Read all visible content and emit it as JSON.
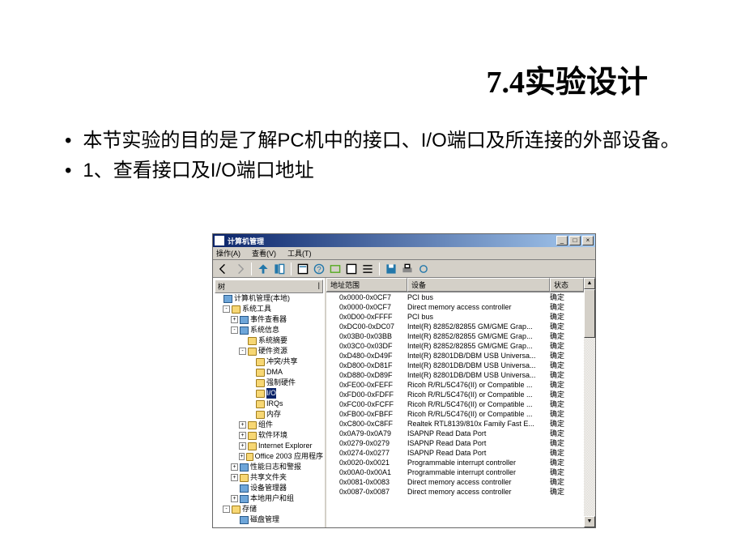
{
  "slide": {
    "title": "7.4实验设计",
    "bullet1": "本节实验的目的是了解PC机中的接口、I/O端口及所连接的外部设备。",
    "bullet2": "1、查看接口及I/O端口地址"
  },
  "window": {
    "title": "计算机管理",
    "menu": {
      "action": "操作(A)",
      "view": "查看(V)",
      "tool": "工具(T)"
    },
    "win_btns": {
      "min": "_",
      "max": "□",
      "close": "×"
    },
    "tree_header": {
      "label": "树",
      "gap": "|"
    },
    "list_header": {
      "addr": "地址范围",
      "device": "设备",
      "status": "状态"
    }
  },
  "tree": [
    {
      "ind": 0,
      "exp": "",
      "icon": "item",
      "label": "计算机管理(本地)"
    },
    {
      "ind": 1,
      "exp": "-",
      "icon": "folder",
      "label": "系统工具"
    },
    {
      "ind": 2,
      "exp": "+",
      "icon": "item",
      "label": "事件查看器"
    },
    {
      "ind": 2,
      "exp": "-",
      "icon": "item",
      "label": "系统信息"
    },
    {
      "ind": 3,
      "exp": "",
      "icon": "folder",
      "label": "系统摘要"
    },
    {
      "ind": 3,
      "exp": "-",
      "icon": "folder",
      "label": "硬件资源"
    },
    {
      "ind": 4,
      "exp": "",
      "icon": "folder",
      "label": "冲突/共享"
    },
    {
      "ind": 4,
      "exp": "",
      "icon": "folder",
      "label": "DMA"
    },
    {
      "ind": 4,
      "exp": "",
      "icon": "folder",
      "label": "强制硬件"
    },
    {
      "ind": 4,
      "exp": "",
      "icon": "folder",
      "label": "I/O",
      "selected": true
    },
    {
      "ind": 4,
      "exp": "",
      "icon": "folder",
      "label": "IRQs"
    },
    {
      "ind": 4,
      "exp": "",
      "icon": "folder",
      "label": "内存"
    },
    {
      "ind": 3,
      "exp": "+",
      "icon": "folder",
      "label": "组件"
    },
    {
      "ind": 3,
      "exp": "+",
      "icon": "folder",
      "label": "软件环境"
    },
    {
      "ind": 3,
      "exp": "+",
      "icon": "folder",
      "label": "Internet Explorer"
    },
    {
      "ind": 3,
      "exp": "+",
      "icon": "folder",
      "label": "Office 2003 应用程序"
    },
    {
      "ind": 2,
      "exp": "+",
      "icon": "item",
      "label": "性能日志和警报"
    },
    {
      "ind": 2,
      "exp": "+",
      "icon": "folder",
      "label": "共享文件夹"
    },
    {
      "ind": 2,
      "exp": "",
      "icon": "item",
      "label": "设备管理器"
    },
    {
      "ind": 2,
      "exp": "+",
      "icon": "item",
      "label": "本地用户和组"
    },
    {
      "ind": 1,
      "exp": "-",
      "icon": "folder",
      "label": "存储"
    },
    {
      "ind": 2,
      "exp": "",
      "icon": "item",
      "label": "磁盘管理"
    }
  ],
  "rows": [
    {
      "addr": "0x0000-0x0CF7",
      "dev": "PCI bus",
      "stat": "确定"
    },
    {
      "addr": "0x0000-0x0CF7",
      "dev": "Direct memory access controller",
      "stat": "确定"
    },
    {
      "addr": "0x0D00-0xFFFF",
      "dev": "PCI bus",
      "stat": "确定"
    },
    {
      "addr": "0xDC00-0xDC07",
      "dev": "Intel(R) 82852/82855 GM/GME Grap...",
      "stat": "确定"
    },
    {
      "addr": "0x03B0-0x03BB",
      "dev": "Intel(R) 82852/82855 GM/GME Grap...",
      "stat": "确定"
    },
    {
      "addr": "0x03C0-0x03DF",
      "dev": "Intel(R) 82852/82855 GM/GME Grap...",
      "stat": "确定"
    },
    {
      "addr": "0xD480-0xD49F",
      "dev": "Intel(R) 82801DB/DBM USB Universa...",
      "stat": "确定"
    },
    {
      "addr": "0xD800-0xD81F",
      "dev": "Intel(R) 82801DB/DBM USB Universa...",
      "stat": "确定"
    },
    {
      "addr": "0xD880-0xD89F",
      "dev": "Intel(R) 82801DB/DBM USB Universa...",
      "stat": "确定"
    },
    {
      "addr": "0xFE00-0xFEFF",
      "dev": "Ricoh R/RL/5C476(II) or Compatible ...",
      "stat": "确定"
    },
    {
      "addr": "0xFD00-0xFDFF",
      "dev": "Ricoh R/RL/5C476(II) or Compatible ...",
      "stat": "确定"
    },
    {
      "addr": "0xFC00-0xFCFF",
      "dev": "Ricoh R/RL/5C476(II) or Compatible ...",
      "stat": "确定"
    },
    {
      "addr": "0xFB00-0xFBFF",
      "dev": "Ricoh R/RL/5C476(II) or Compatible ...",
      "stat": "确定"
    },
    {
      "addr": "0xC800-0xC8FF",
      "dev": "Realtek RTL8139/810x Family Fast E...",
      "stat": "确定"
    },
    {
      "addr": "0x0A79-0x0A79",
      "dev": "ISAPNP Read Data Port",
      "stat": "确定"
    },
    {
      "addr": "0x0279-0x0279",
      "dev": "ISAPNP Read Data Port",
      "stat": "确定"
    },
    {
      "addr": "0x0274-0x0277",
      "dev": "ISAPNP Read Data Port",
      "stat": "确定"
    },
    {
      "addr": "0x0020-0x0021",
      "dev": "Programmable interrupt controller",
      "stat": "确定"
    },
    {
      "addr": "0x00A0-0x00A1",
      "dev": "Programmable interrupt controller",
      "stat": "确定"
    },
    {
      "addr": "0x0081-0x0083",
      "dev": "Direct memory access controller",
      "stat": "确定"
    },
    {
      "addr": "0x0087-0x0087",
      "dev": "Direct memory access controller",
      "stat": "确定"
    }
  ]
}
